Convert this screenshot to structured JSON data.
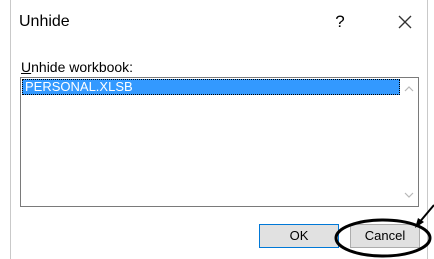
{
  "dialog": {
    "title": "Unhide",
    "help_glyph": "?",
    "close_icon": "close-icon"
  },
  "label": {
    "accelerator": "U",
    "rest": "nhide workbook:"
  },
  "list": {
    "items": [
      "PERSONAL.XLSB"
    ],
    "selected_index": 0
  },
  "buttons": {
    "ok": "OK",
    "cancel": "Cancel"
  },
  "colors": {
    "selection": "#3399ff",
    "annotation": "#000000"
  }
}
